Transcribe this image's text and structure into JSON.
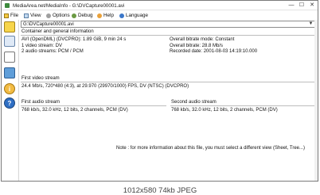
{
  "window": {
    "title": "MediaArea.net/MediaInfo - G:\\DVCapture00001.avi",
    "controls": {
      "minimize": "—",
      "maximize": "☐",
      "close": "✕"
    }
  },
  "menu": [
    {
      "label": "File",
      "icon": "folder-icon"
    },
    {
      "label": "View",
      "icon": "view-icon"
    },
    {
      "label": "Options",
      "icon": "options-icon"
    },
    {
      "label": "Debug",
      "icon": "debug-icon"
    },
    {
      "label": "Help",
      "icon": "help-icon"
    },
    {
      "label": "Language",
      "icon": "globe-icon"
    }
  ],
  "file_select": {
    "value": "G:\\DVCapture00001.avi",
    "arrow": "▼"
  },
  "general": {
    "header": "Container and general information",
    "left": [
      "AVI (OpenDML) (DVCPRO): 1.89 GiB, 9 min 24 s",
      "1 video stream: DV",
      "2 audio streams: PCM / PCM"
    ],
    "right": [
      "Overall bitrate mode: Constant",
      "Overall bitrate: 28.8 Mb/s",
      "Recorded date: 2001-08-03 14:19:10.000"
    ]
  },
  "video": {
    "header": "First video stream",
    "line": "24.4 Mb/s, 720*480 (4:3), at 29.970 (29970/1000) FPS, DV (NTSC) (DVCPRO)"
  },
  "audio1": {
    "header": "First audio stream",
    "line": "768 kb/s, 32.0 kHz, 12 bits, 2 channels, PCM (DV)"
  },
  "audio2": {
    "header": "Second audio stream",
    "line": "768 kb/s, 32.0 kHz, 12 bits, 2 channels, PCM (DV)"
  },
  "note": "Note : for more information about this file, you must select a different view (Sheet, Tree...)",
  "image_caption": "1012x580  74kb  JPEG"
}
